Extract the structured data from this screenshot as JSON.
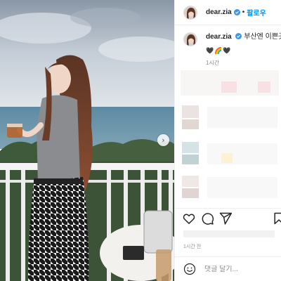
{
  "post": {
    "username": "dear.zia",
    "follow_label": "팔로우",
    "header_separator": "•",
    "caption_username": "dear.zia",
    "caption_text": "부산엔 이쁜곳이",
    "caption_emojis": "🖤🌈🖤",
    "caption_time": "1시간",
    "post_time": "1시간 전",
    "comment_placeholder": "댓글 달기...",
    "next_arrow": "›"
  },
  "icons": {
    "verified": "verified-badge-icon",
    "like": "heart-icon",
    "comment": "comment-icon",
    "share": "share-icon",
    "save": "bookmark-icon",
    "emoji": "smiley-icon",
    "next": "chevron-right-icon"
  },
  "colors": {
    "accent": "#0095f6",
    "verified": "#3897f0",
    "secondary_text": "#8e8e8e"
  }
}
